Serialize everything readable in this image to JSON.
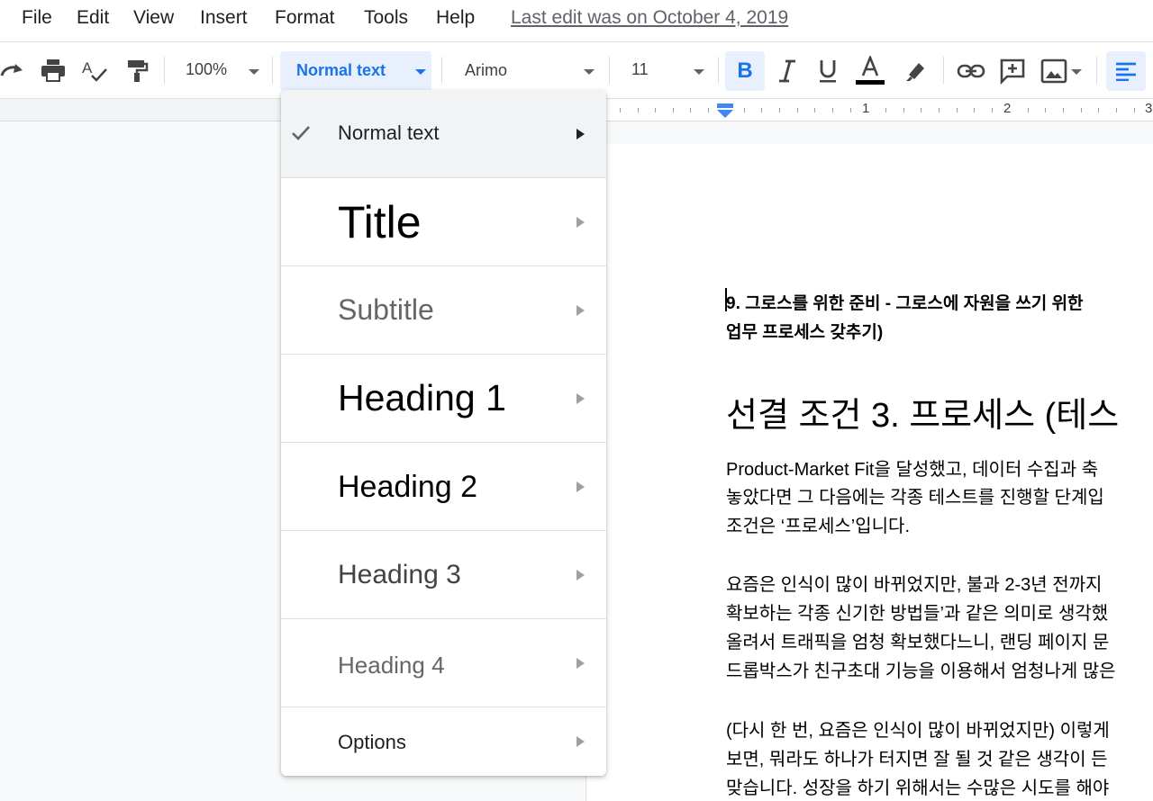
{
  "menubar": {
    "items": [
      "File",
      "Edit",
      "View",
      "Insert",
      "Format",
      "Tools",
      "Help"
    ],
    "last_edit": "Last edit was on October 4, 2019"
  },
  "toolbar": {
    "zoom": "100%",
    "style": "Normal text",
    "font": "Arimo",
    "font_size": "11",
    "icons": [
      "redo-icon",
      "print-icon",
      "spellcheck-icon",
      "paint-format-icon",
      "bold-icon",
      "italic-icon",
      "underline-icon",
      "text-color-icon",
      "highlight-icon",
      "link-icon",
      "comment-icon",
      "image-icon",
      "align-left-icon"
    ],
    "accent": "#1a73e8"
  },
  "ruler": {
    "marks": [
      "1",
      "2",
      "3"
    ]
  },
  "style_menu": {
    "items": [
      {
        "label": "Normal text",
        "selected": true
      },
      {
        "label": "Title"
      },
      {
        "label": "Subtitle"
      },
      {
        "label": "Heading 1"
      },
      {
        "label": "Heading 2"
      },
      {
        "label": "Heading 3"
      },
      {
        "label": "Heading 4"
      },
      {
        "label": "Options"
      }
    ]
  },
  "document": {
    "heading_lines": [
      "9. 그로스를 위한 준비 - 그로스에 자원을 쓰기 위한",
      "업무 프로세스 갖추기)"
    ],
    "section_title": "선결 조건 3. 프로세스 (테스",
    "para1": [
      "Product-Market Fit을 달성했고, 데이터 수집과 축",
      "놓았다면 그 다음에는 각종 테스트를 진행할 단계입",
      "조건은 ‘프로세스’입니다."
    ],
    "para2": [
      "요즘은 인식이 많이 바뀌었지만, 불과 2-3년 전까지",
      "확보하는 각종 신기한 방법들’과 같은 의미로 생각했",
      "올려서 트래픽을 엄청 확보했다느니, 랜딩 페이지 문",
      "드롭박스가 친구초대 기능을 이용해서 엄청나게 많은"
    ],
    "para3": [
      "(다시 한 번, 요즘은 인식이 많이 바뀌었지만) 이렇게",
      "보면, 뭐라도 하나가 터지면 잘 될 것 같은 생각이 든",
      "맞습니다. 성장을 하기 위해서는 수많은 시도를 해야"
    ]
  }
}
